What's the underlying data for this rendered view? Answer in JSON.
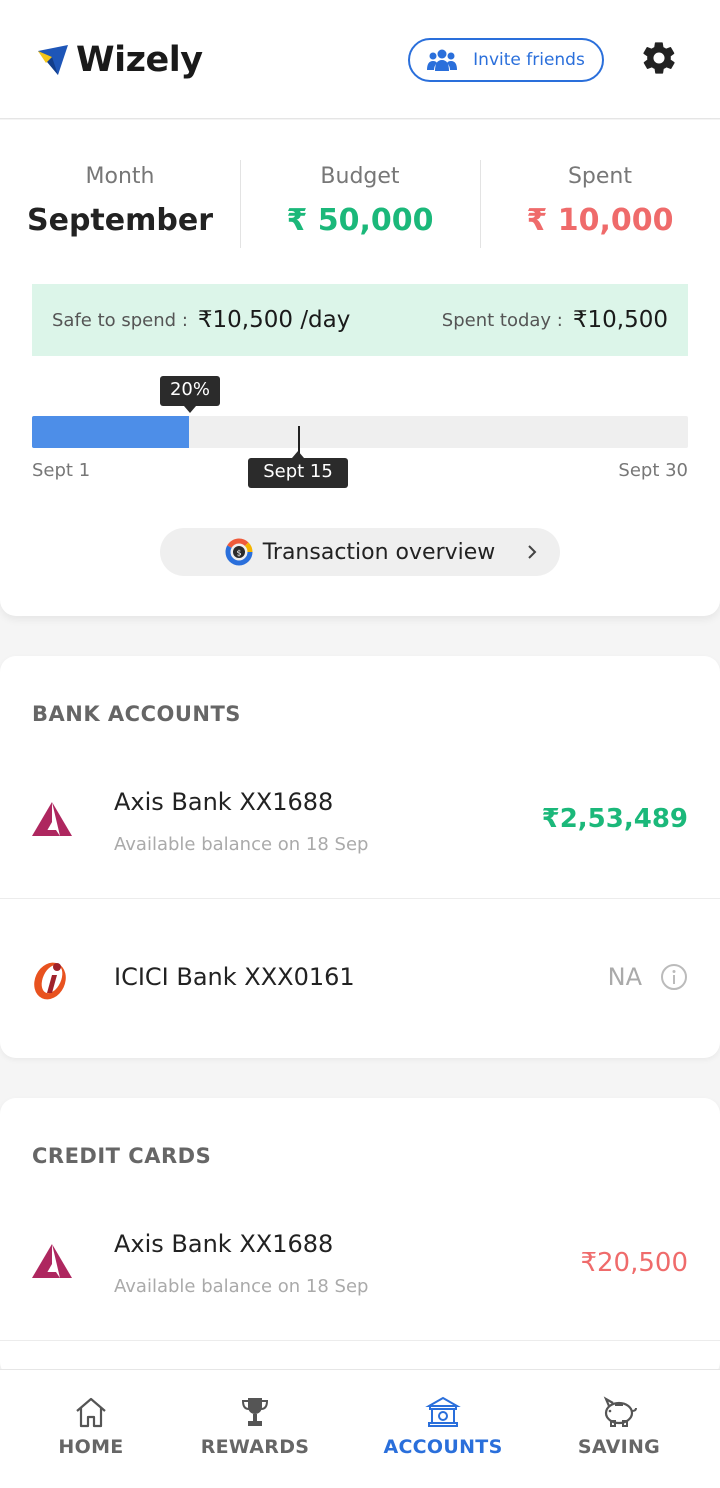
{
  "app": {
    "name": "Wizely",
    "brand_color": "#2a6fdb"
  },
  "header": {
    "invite_label": "Invite friends"
  },
  "summary": {
    "month_label": "Month",
    "month_value": "September",
    "budget_label": "Budget",
    "budget_value": "₹ 50,000",
    "spent_label": "Spent",
    "spent_value": "₹ 10,000",
    "safe_label": "Safe to spend :",
    "safe_value": "₹10,500 /day",
    "today_label": "Spent today :",
    "today_value": "₹10,500",
    "progress": {
      "percent_label": "20%",
      "fraction": 0.24,
      "start": "Sept 1",
      "marker": "Sept 15",
      "end": "Sept 30"
    },
    "txn_button": "Transaction overview"
  },
  "bank_accounts": {
    "title": "BANK ACCOUNTS",
    "items": [
      {
        "name": "Axis Bank XX1688",
        "sub": "Available balance on 18 Sep",
        "amount": "₹2,53,489"
      },
      {
        "name": "ICICI Bank XXX0161",
        "amount": "NA"
      }
    ]
  },
  "credit_cards": {
    "title": "CREDIT CARDS",
    "items": [
      {
        "name": "Axis Bank XX1688",
        "sub": "Available balance on 18 Sep",
        "amount": "₹20,500"
      }
    ]
  },
  "nav": {
    "items": [
      {
        "label": "HOME",
        "icon": "home-icon"
      },
      {
        "label": "REWARDS",
        "icon": "trophy-icon"
      },
      {
        "label": "ACCOUNTS",
        "icon": "bank-icon",
        "active": true
      },
      {
        "label": "SAVING",
        "icon": "piggy-bank-icon"
      }
    ]
  },
  "colors": {
    "green": "#1bb87a",
    "red": "#ef6b6b",
    "accent": "#4d8ee8"
  }
}
